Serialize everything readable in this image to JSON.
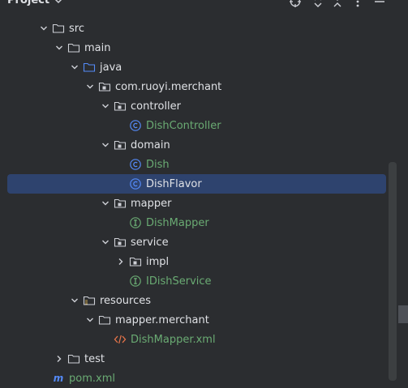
{
  "header": {
    "title": "Project"
  },
  "colors": {
    "background": "#2b2d30",
    "selection": "#2e436e",
    "class_icon": "#548af7",
    "interface_icon": "#6aab73",
    "folder": "#ced0d6",
    "source_folder": "#548af7",
    "xml": "#e8754a"
  },
  "tree": [
    {
      "label": "src",
      "depth": 0,
      "expanded": true,
      "icon": "folder-icon"
    },
    {
      "label": "main",
      "depth": 1,
      "expanded": true,
      "icon": "folder-icon"
    },
    {
      "label": "java",
      "depth": 2,
      "expanded": true,
      "icon": "source-folder-icon"
    },
    {
      "label": "com.ruoyi.merchant",
      "depth": 3,
      "expanded": true,
      "icon": "package-icon"
    },
    {
      "label": "controller",
      "depth": 4,
      "expanded": true,
      "icon": "package-icon"
    },
    {
      "label": "DishController",
      "depth": 5,
      "icon": "class-icon",
      "color": "green"
    },
    {
      "label": "domain",
      "depth": 4,
      "expanded": true,
      "icon": "package-icon"
    },
    {
      "label": "Dish",
      "depth": 5,
      "icon": "class-icon",
      "color": "green"
    },
    {
      "label": "DishFlavor",
      "depth": 5,
      "icon": "class-icon",
      "selected": true
    },
    {
      "label": "mapper",
      "depth": 4,
      "expanded": true,
      "icon": "package-icon"
    },
    {
      "label": "DishMapper",
      "depth": 5,
      "icon": "interface-icon",
      "color": "green"
    },
    {
      "label": "service",
      "depth": 4,
      "expanded": true,
      "icon": "package-icon"
    },
    {
      "label": "impl",
      "depth": 5,
      "expanded": false,
      "icon": "package-icon"
    },
    {
      "label": "IDishService",
      "depth": 5,
      "icon": "interface-icon",
      "color": "green"
    },
    {
      "label": "resources",
      "depth": 2,
      "expanded": true,
      "icon": "resources-folder-icon"
    },
    {
      "label": "mapper.merchant",
      "depth": 3,
      "expanded": true,
      "icon": "folder-icon"
    },
    {
      "label": "DishMapper.xml",
      "depth": 4,
      "icon": "xml-icon",
      "color": "green"
    },
    {
      "label": "test",
      "depth": 1,
      "expanded": false,
      "icon": "folder-icon"
    },
    {
      "label": "pom.xml",
      "depth": 0,
      "icon": "maven-icon",
      "color": "green"
    }
  ]
}
